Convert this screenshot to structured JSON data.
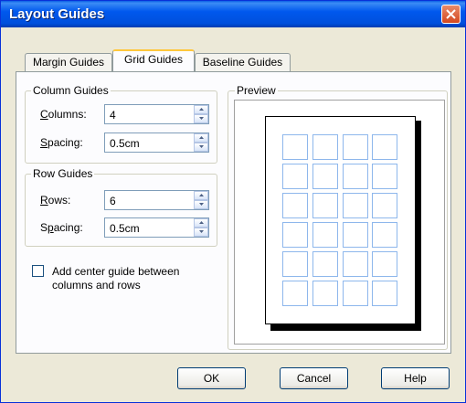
{
  "window": {
    "title": "Layout Guides"
  },
  "tabs": [
    {
      "label": "Margin Guides",
      "active": false
    },
    {
      "label": "Grid Guides",
      "active": true
    },
    {
      "label": "Baseline Guides",
      "active": false
    }
  ],
  "column_guides": {
    "title": "Column Guides",
    "columns_label": "Columns:",
    "columns_value": "4",
    "spacing_label": "Spacing:",
    "spacing_value": "0.5cm"
  },
  "row_guides": {
    "title": "Row Guides",
    "rows_label": "Rows:",
    "rows_value": "6",
    "spacing_label": "Spacing:",
    "spacing_value": "0.5cm"
  },
  "center_guide": {
    "line1": "Add center guide between",
    "line2": "columns and rows",
    "checked": false
  },
  "preview": {
    "title": "Preview",
    "grid_color": "#1E6FD9"
  },
  "buttons": {
    "ok": "OK",
    "cancel": "Cancel",
    "help": "Help"
  }
}
